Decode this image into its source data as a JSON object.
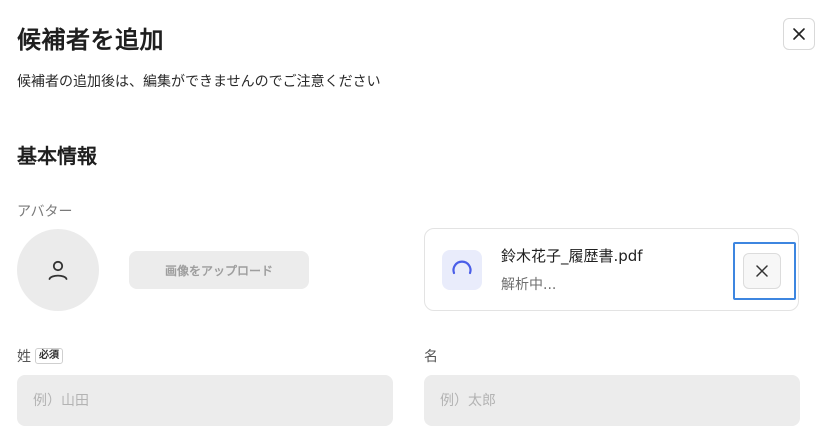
{
  "dialog": {
    "title": "候補者を追加",
    "subtitle": "候補者の追加後は、編集ができませんのでご注意ください",
    "close_icon": "close-icon"
  },
  "basic_info": {
    "section_title": "基本情報",
    "avatar_label": "アバター",
    "avatar_icon": "user-icon",
    "upload_button_label": "画像をアップロード"
  },
  "file": {
    "name": "鈴木花子_履歴書.pdf",
    "status": "解析中...",
    "icon": "spinner-icon",
    "remove_icon": "close-icon"
  },
  "fields": {
    "last_name": {
      "label": "姓",
      "badge": "必須",
      "placeholder": "例）山田",
      "value": ""
    },
    "first_name": {
      "label": "名",
      "placeholder": "例）太郎",
      "value": ""
    }
  },
  "colors": {
    "focus_ring": "#3d86e0",
    "spinner": "#4a5ee8",
    "input_bg": "#ececec"
  }
}
